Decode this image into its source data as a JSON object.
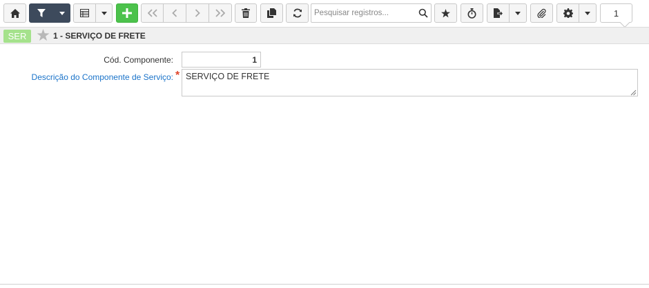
{
  "toolbar": {
    "icons": [
      "home-icon",
      "filter-icon",
      "caret-down-icon",
      "table-icon",
      "caret-down-icon",
      "plus-icon",
      "double-chevron-left-icon",
      "chevron-left-icon",
      "chevron-right-icon",
      "double-chevron-right-icon",
      "trash-icon",
      "copy-icon",
      "refresh-icon",
      "search-icon",
      "star-icon",
      "stopwatch-icon",
      "file-export-icon",
      "caret-down-icon",
      "paperclip-icon",
      "gear-icon",
      "caret-down-icon"
    ],
    "search_placeholder": "Pesquisar registros...",
    "page_number": "1",
    "colors": {
      "filter_bg": "#3d4a5c",
      "add_bg": "#4cc24c"
    }
  },
  "header": {
    "badge": "SER",
    "badge_color": "#a5e28c",
    "title": "1 - SERVIÇO DE FRETE"
  },
  "form": {
    "cod_label": "Cód. Componente:",
    "cod_value": "1",
    "desc_label": "Descrição do Componente de Serviço:",
    "desc_required": "*",
    "desc_value": "SERVIÇO DE FRETE",
    "desc_label_color": "#1a73c9"
  }
}
